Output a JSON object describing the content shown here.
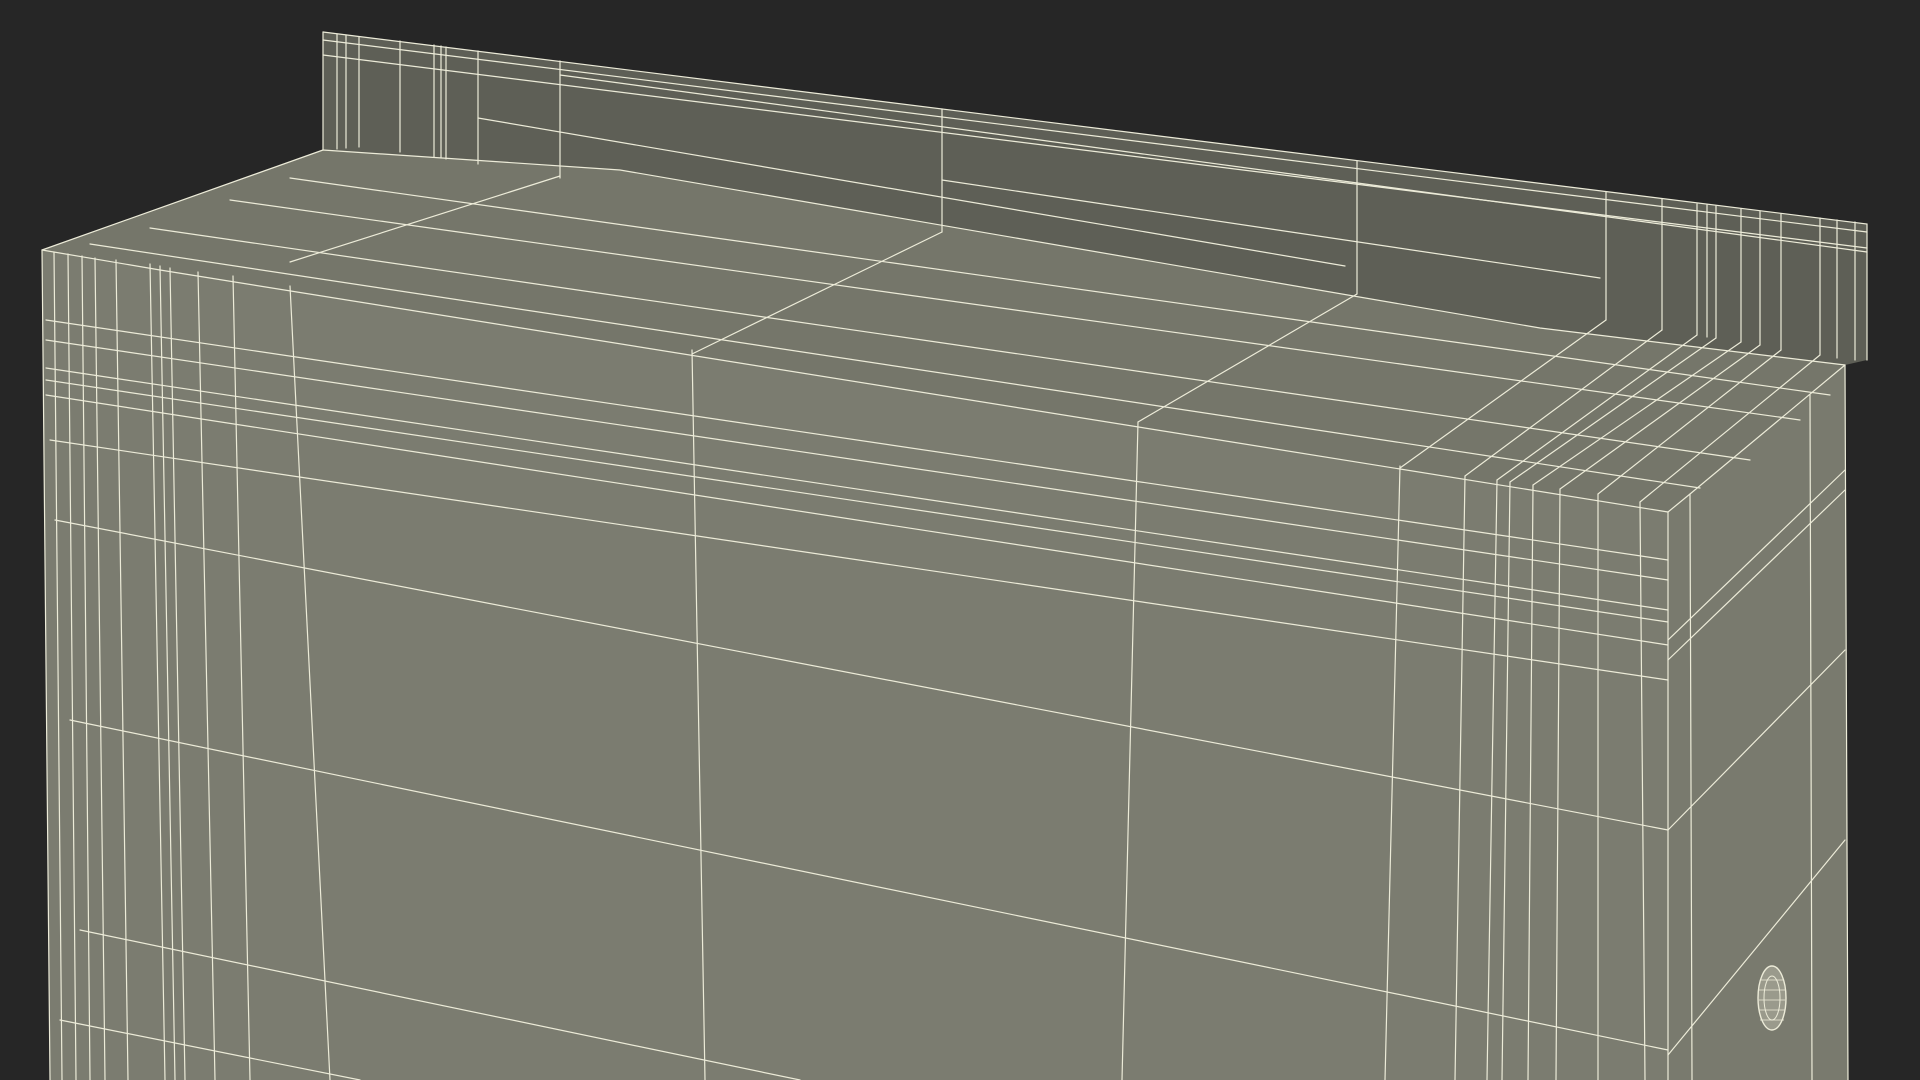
{
  "scene": {
    "subject": "wireframe-cabinet-render",
    "colors": {
      "background": "#262626",
      "front_face": "#7b7c70",
      "top_face": "#75766a",
      "backsplash": "#5e5f56",
      "side_face": "#797a6e",
      "wire": "#ecebd8"
    },
    "icons": [
      "round-knob-icon"
    ]
  }
}
